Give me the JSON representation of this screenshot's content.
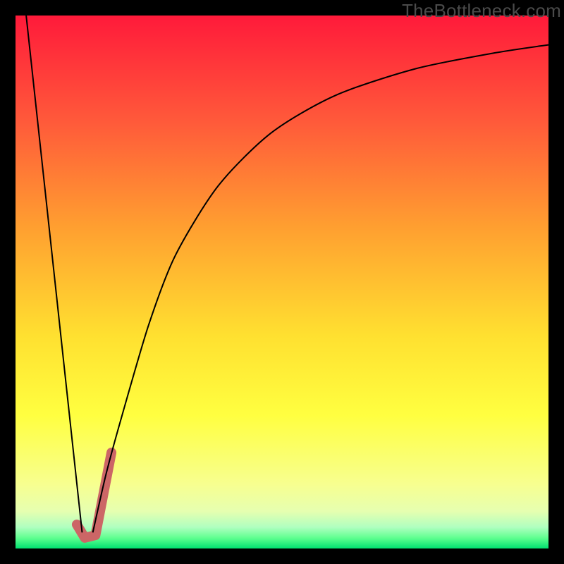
{
  "watermark": "TheBottleneck.com",
  "chart_data": {
    "type": "line",
    "title": "",
    "xlabel": "",
    "ylabel": "",
    "xlim": [
      0,
      100
    ],
    "ylim": [
      0,
      100
    ],
    "background_gradient": {
      "stops": [
        {
          "offset": 0,
          "color": "#ff1a3a"
        },
        {
          "offset": 20,
          "color": "#ff5a3a"
        },
        {
          "offset": 40,
          "color": "#ffa030"
        },
        {
          "offset": 60,
          "color": "#ffe030"
        },
        {
          "offset": 75,
          "color": "#ffff40"
        },
        {
          "offset": 88,
          "color": "#f7ff90"
        },
        {
          "offset": 93,
          "color": "#e6ffb0"
        },
        {
          "offset": 96,
          "color": "#b0ffc0"
        },
        {
          "offset": 98,
          "color": "#60ff90"
        },
        {
          "offset": 100,
          "color": "#00e070"
        }
      ]
    },
    "series": [
      {
        "name": "left-descent",
        "type": "line",
        "stroke": "#000000",
        "stroke_width": 2,
        "points": [
          {
            "x": 2.0,
            "y": 100.0
          },
          {
            "x": 12.5,
            "y": 3.0
          }
        ]
      },
      {
        "name": "right-curve",
        "type": "curve",
        "stroke": "#000000",
        "stroke_width": 2,
        "points": [
          {
            "x": 14.5,
            "y": 3.0
          },
          {
            "x": 17.0,
            "y": 14.0
          },
          {
            "x": 20.0,
            "y": 25.0
          },
          {
            "x": 25.0,
            "y": 42.0
          },
          {
            "x": 30.0,
            "y": 55.0
          },
          {
            "x": 38.0,
            "y": 68.0
          },
          {
            "x": 48.0,
            "y": 78.0
          },
          {
            "x": 60.0,
            "y": 85.0
          },
          {
            "x": 75.0,
            "y": 90.0
          },
          {
            "x": 90.0,
            "y": 93.0
          },
          {
            "x": 100.0,
            "y": 94.5
          }
        ]
      },
      {
        "name": "highlight-j",
        "type": "line",
        "stroke": "#cc6666",
        "stroke_width": 14,
        "stroke_linecap": "round",
        "points": [
          {
            "x": 11.5,
            "y": 4.5
          },
          {
            "x": 13.0,
            "y": 2.0
          },
          {
            "x": 15.0,
            "y": 2.5
          },
          {
            "x": 18.0,
            "y": 18.0
          }
        ]
      }
    ]
  }
}
